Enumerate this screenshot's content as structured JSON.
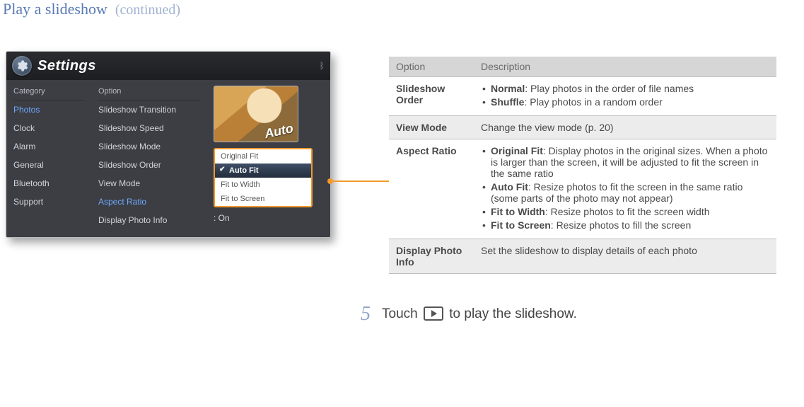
{
  "page": {
    "title": "Play a slideshow",
    "continued": "(continued)"
  },
  "device": {
    "window_title": "Settings",
    "bt_glyph": "⁂",
    "col_headers": {
      "category": "Category",
      "option": "Option"
    },
    "categories": [
      {
        "label": "Photos",
        "active": true
      },
      {
        "label": "Clock",
        "active": false
      },
      {
        "label": "Alarm",
        "active": false
      },
      {
        "label": "General",
        "active": false
      },
      {
        "label": "Bluetooth",
        "active": false
      },
      {
        "label": "Support",
        "active": false
      }
    ],
    "options": [
      {
        "label": "Slideshow Transition",
        "hi": false
      },
      {
        "label": "Slideshow Speed",
        "hi": false
      },
      {
        "label": "Slideshow Mode",
        "hi": false
      },
      {
        "label": "Slideshow Order",
        "hi": false
      },
      {
        "label": "View Mode",
        "hi": false
      },
      {
        "label": "Aspect Ratio",
        "hi": true
      },
      {
        "label": "Display Photo Info",
        "hi": false
      }
    ],
    "thumb_label": "Auto",
    "aspect_choices": {
      "items": [
        "Original Fit",
        "Auto Fit",
        "Fit to Width",
        "Fit to Screen"
      ],
      "selected": "Auto Fit"
    },
    "on_label": ": On"
  },
  "opts_table": {
    "head": {
      "c1": "Option",
      "c2": "Description"
    },
    "rows": [
      {
        "name": "Slideshow Order",
        "shade": false,
        "bullets": [
          {
            "b": "Normal",
            "t": ": Play photos in the order of file names"
          },
          {
            "b": "Shuffle",
            "t": ": Play photos in a random order"
          }
        ]
      },
      {
        "name": "View Mode",
        "shade": true,
        "plain": "Change the view mode (p. 20)"
      },
      {
        "name": "Aspect Ratio",
        "shade": false,
        "bullets": [
          {
            "b": "Original Fit",
            "t": ": Display photos in the original sizes. When a photo is larger than the screen, it will be adjusted to fit the screen in the same ratio"
          },
          {
            "b": "Auto Fit",
            "t": ": Resize photos to fit the screen in the same ratio (some parts of the photo may not appear)"
          },
          {
            "b": "Fit to Width",
            "t": ": Resize photos to fit the screen width"
          },
          {
            "b": "Fit to Screen",
            "t": ": Resize photos to fill the screen"
          }
        ]
      },
      {
        "name": "Display Photo Info",
        "shade": true,
        "plain": "Set the slideshow to display details of each photo"
      }
    ]
  },
  "step": {
    "number": "5",
    "before": "Touch ",
    "after": " to play the slideshow."
  }
}
